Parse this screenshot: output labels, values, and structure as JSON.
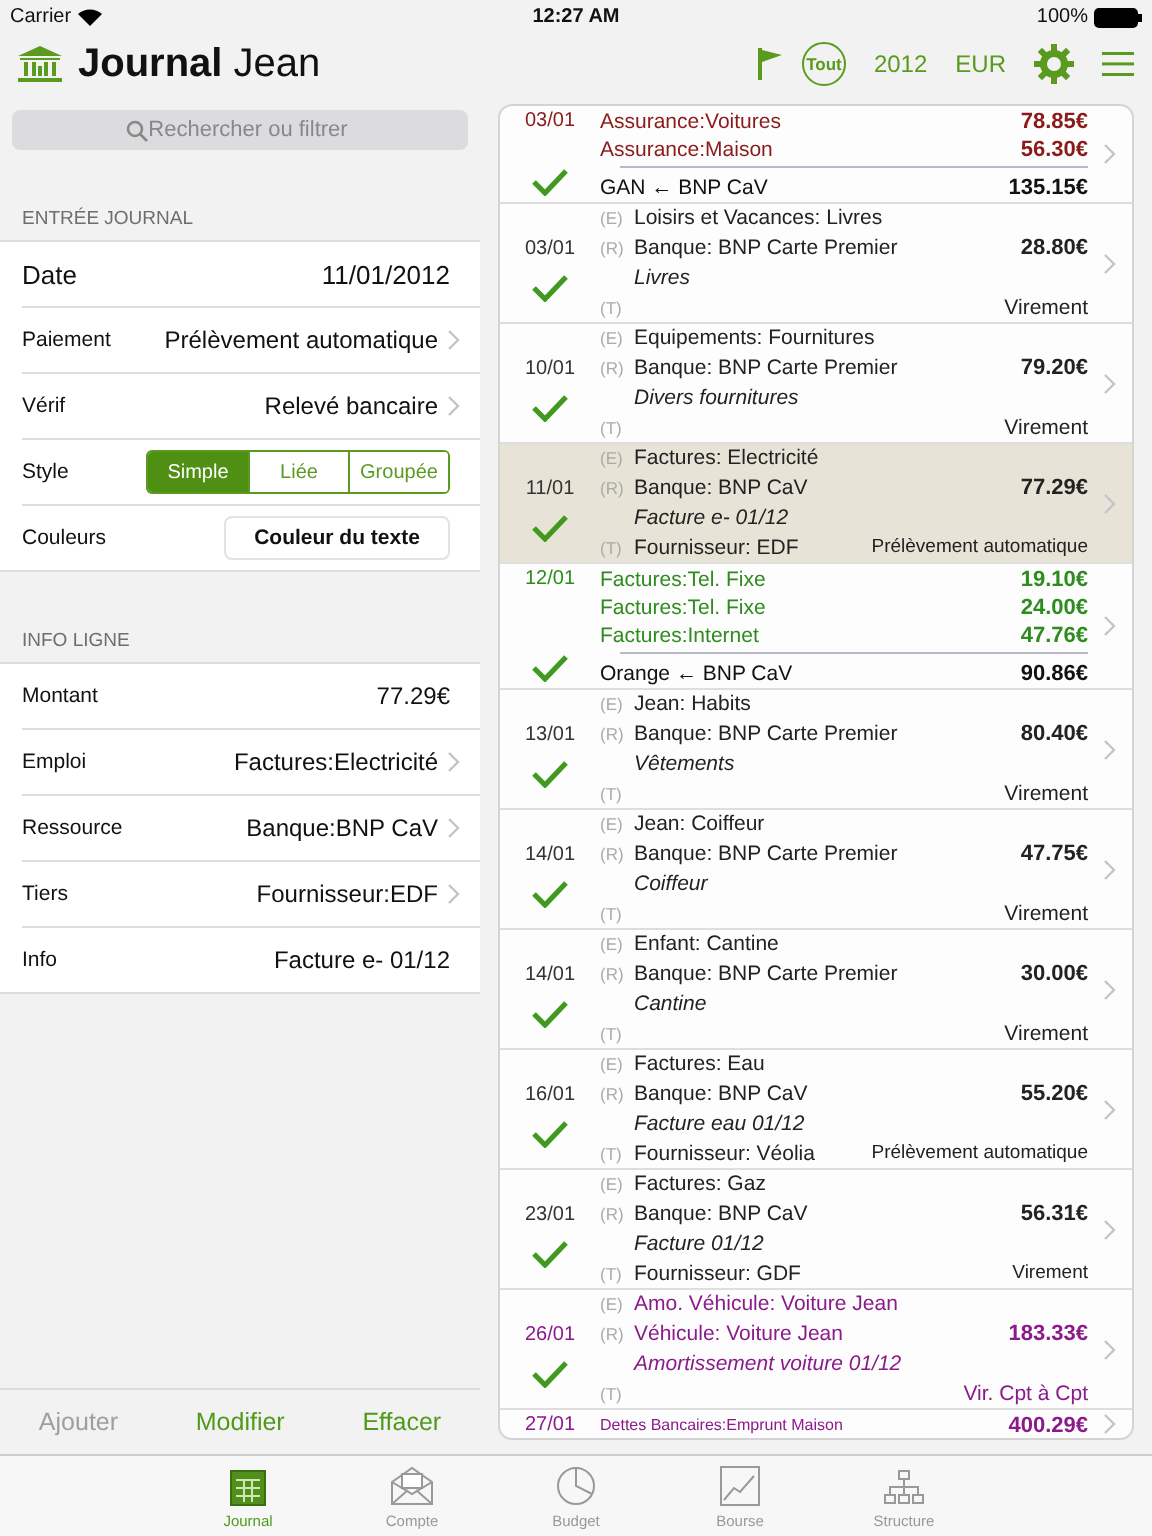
{
  "status_bar": {
    "carrier": "Carrier",
    "time": "12:27 AM",
    "battery": "100%"
  },
  "header": {
    "title_bold": "Journal",
    "title_rest": "Jean",
    "filter": "Tout",
    "year": "2012",
    "currency": "EUR"
  },
  "search": {
    "placeholder": "Rechercher ou filtrer"
  },
  "sections": [
    {
      "title": "ENTRÉE JOURNAL",
      "rows": [
        {
          "kind": "value",
          "label": "Date",
          "value": "11/01/2012",
          "large": true
        },
        {
          "kind": "link",
          "label": "Paiement",
          "value": "Prélèvement automatique",
          "large": false
        },
        {
          "kind": "link",
          "label": "Vérif",
          "value": "Relevé bancaire",
          "large": false
        },
        {
          "kind": "segmented",
          "label": "Style",
          "options": [
            {
              "label": "Simple",
              "selected": true
            },
            {
              "label": "Liée",
              "selected": false
            },
            {
              "label": "Groupée",
              "selected": false
            }
          ]
        },
        {
          "kind": "button",
          "label": "Couleurs",
          "value": "Couleur du texte"
        }
      ]
    },
    {
      "title": "INFO LIGNE",
      "rows": [
        {
          "kind": "value",
          "label": "Montant",
          "value": "77.29€",
          "large": false
        },
        {
          "kind": "link",
          "label": "Emploi",
          "value": "Factures:Electricité",
          "large": false
        },
        {
          "kind": "link",
          "label": "Ressource",
          "value": "Banque:BNP CaV",
          "large": false
        },
        {
          "kind": "link",
          "label": "Tiers",
          "value": "Fournisseur:EDF",
          "large": false
        },
        {
          "kind": "value",
          "label": "Info",
          "value": "Facture e- 01/12",
          "large": false
        }
      ]
    }
  ],
  "actions": [
    {
      "label": "Ajouter",
      "disabled": true
    },
    {
      "label": "Modifier",
      "disabled": false
    },
    {
      "label": "Effacer",
      "disabled": false
    }
  ],
  "entries": [
    {
      "kind": "split",
      "date": "03/01",
      "checked": true,
      "selected": false,
      "color": "#8b1a1a",
      "lines": [
        {
          "label": "Assurance:Voitures",
          "amount": "78.85€"
        },
        {
          "label": "Assurance:Maison",
          "amount": "56.30€"
        }
      ],
      "total_label": "GAN ← BNP CaV",
      "total": "135.15€"
    },
    {
      "kind": "simple",
      "date": "03/01",
      "checked": true,
      "selected": false,
      "color": "#222222",
      "e_mark": "(E)",
      "expense": "Loisirs et Vacances: Livres",
      "r_mark": "(R)",
      "resource": "Banque: BNP Carte Premier",
      "amount": "28.80€",
      "memo": "Livres",
      "t_mark": "(T)",
      "payment": "Virement"
    },
    {
      "kind": "simple",
      "date": "10/01",
      "checked": true,
      "selected": false,
      "color": "#222222",
      "e_mark": "(E)",
      "expense": "Equipements: Fournitures",
      "r_mark": "(R)",
      "resource": "Banque: BNP Carte Premier",
      "amount": "79.20€",
      "memo": "Divers fournitures",
      "t_mark": "(T)",
      "payment": "Virement"
    },
    {
      "kind": "simple",
      "date": "11/01",
      "checked": true,
      "selected": true,
      "color": "#222222",
      "e_mark": "(E)",
      "expense": "Factures: Electricité",
      "r_mark": "(R)",
      "resource": "Banque: BNP CaV",
      "amount": "77.29€",
      "memo": "Facture e- 01/12",
      "t_mark": "(T)",
      "payee": "Fournisseur: EDF",
      "payment": "Prélèvement automatique"
    },
    {
      "kind": "split",
      "date": "12/01",
      "checked": true,
      "selected": false,
      "color": "#2e8b1e",
      "lines": [
        {
          "label": "Factures:Tel. Fixe",
          "amount": "19.10€"
        },
        {
          "label": "Factures:Tel. Fixe",
          "amount": "24.00€"
        },
        {
          "label": "Factures:Internet",
          "amount": "47.76€"
        }
      ],
      "total_label": "Orange ← BNP CaV",
      "total": "90.86€"
    },
    {
      "kind": "simple",
      "date": "13/01",
      "checked": true,
      "selected": false,
      "color": "#222222",
      "e_mark": "(E)",
      "expense": "Jean: Habits",
      "r_mark": "(R)",
      "resource": "Banque: BNP Carte Premier",
      "amount": "80.40€",
      "memo": "Vêtements",
      "t_mark": "(T)",
      "payment": "Virement"
    },
    {
      "kind": "simple",
      "date": "14/01",
      "checked": true,
      "selected": false,
      "color": "#222222",
      "e_mark": "(E)",
      "expense": "Jean: Coiffeur",
      "r_mark": "(R)",
      "resource": "Banque: BNP Carte Premier",
      "amount": "47.75€",
      "memo": "Coiffeur",
      "t_mark": "(T)",
      "payment": "Virement"
    },
    {
      "kind": "simple",
      "date": "14/01",
      "checked": true,
      "selected": false,
      "color": "#222222",
      "e_mark": "(E)",
      "expense": "Enfant: Cantine",
      "r_mark": "(R)",
      "resource": "Banque: BNP Carte Premier",
      "amount": "30.00€",
      "memo": "Cantine",
      "t_mark": "(T)",
      "payment": "Virement"
    },
    {
      "kind": "simple",
      "date": "16/01",
      "checked": true,
      "selected": false,
      "color": "#222222",
      "e_mark": "(E)",
      "expense": "Factures: Eau",
      "r_mark": "(R)",
      "resource": "Banque: BNP CaV",
      "amount": "55.20€",
      "memo": "Facture eau 01/12",
      "t_mark": "(T)",
      "payee": "Fournisseur: Véolia",
      "payment": "Prélèvement automatique"
    },
    {
      "kind": "simple",
      "date": "23/01",
      "checked": true,
      "selected": false,
      "color": "#222222",
      "e_mark": "(E)",
      "expense": "Factures: Gaz",
      "r_mark": "(R)",
      "resource": "Banque: BNP CaV",
      "amount": "56.31€",
      "memo": "Facture 01/12",
      "t_mark": "(T)",
      "payee": "Fournisseur: GDF",
      "payment": "Virement"
    },
    {
      "kind": "simple",
      "date": "26/01",
      "checked": true,
      "selected": false,
      "color": "#8b1a8b",
      "e_mark": "(E)",
      "expense": "Amo. Véhicule: Voiture Jean",
      "r_mark": "(R)",
      "resource": "Véhicule: Voiture Jean",
      "amount": "183.33€",
      "memo": "Amortissement voiture 01/12",
      "t_mark": "(T)",
      "payment": "Vir. Cpt à Cpt"
    },
    {
      "kind": "split",
      "date": "27/01",
      "checked": false,
      "selected": false,
      "color": "#8b1a8b",
      "small": true,
      "lines": [
        {
          "label": "Dettes Bancaires:Emprunt Maison",
          "amount": "400.29€"
        }
      ]
    }
  ],
  "tab_bar": [
    {
      "label": "Journal",
      "selected": true
    },
    {
      "label": "Compte",
      "selected": false
    },
    {
      "label": "Budget",
      "selected": false
    },
    {
      "label": "Bourse",
      "selected": false
    },
    {
      "label": "Structure",
      "selected": false
    }
  ]
}
